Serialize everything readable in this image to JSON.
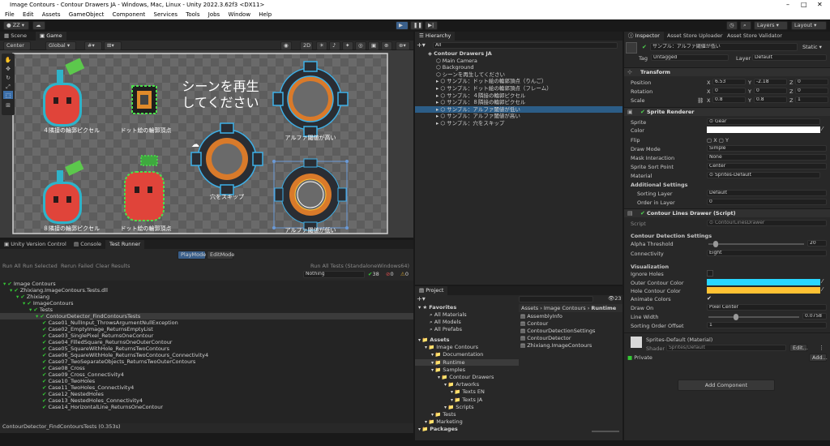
{
  "window": {
    "title": "Image Contours - Contour Drawers JA - Windows, Mac, Linux - Unity 2022.3.62f3 <DX11>"
  },
  "menu": [
    "File",
    "Edit",
    "Assets",
    "GameObject",
    "Component",
    "Services",
    "Tools",
    "Jobs",
    "Window",
    "Help"
  ],
  "toolbar": {
    "account": "ZZ",
    "layers": "Layers",
    "layout": "Layout"
  },
  "scene": {
    "tabs": [
      "Scene",
      "Game"
    ],
    "pivot": "Center",
    "space": "Global",
    "mode_2d": "2D",
    "overlay_title_line1": "シーンを再生",
    "overlay_title_line2": "してください",
    "labels": [
      "４隣接の輪郭ピクセル",
      "ドット絵の輪郭頂点",
      "アルファ閾値が高い",
      "穴をスキップ",
      "８隣接の輪郭ピクセル",
      "ドット絵の輪郭頂点",
      "アルファ閾値が低い"
    ]
  },
  "testrunner": {
    "tabs": [
      "Unity Version Control",
      "Console",
      "Test Runner"
    ],
    "modes": [
      "PlayMode",
      "EditMode"
    ],
    "actions": [
      "Run All",
      "Run Selected",
      "Rerun Failed",
      "Clear Results"
    ],
    "run_all_tests": "Run All Tests (StandaloneWindows64)",
    "filter": "Nothing",
    "counts": {
      "passed": "38",
      "failed": "0",
      "skipped": "0"
    },
    "tree": [
      {
        "label": "Image Contours",
        "indent": 0
      },
      {
        "label": "Zhixiang.ImageContours.Tests.dll",
        "indent": 1
      },
      {
        "label": "Zhixiang",
        "indent": 2
      },
      {
        "label": "ImageContours",
        "indent": 3
      },
      {
        "label": "Tests",
        "indent": 4
      },
      {
        "label": "ContourDetector_FindContoursTests",
        "indent": 5,
        "selected": true
      },
      {
        "label": "Case01_NullInput_ThrowsArgumentNullException",
        "indent": 6
      },
      {
        "label": "Case02_EmptyImage_ReturnsEmptyList",
        "indent": 6
      },
      {
        "label": "Case03_SinglePixel_ReturnsOneContour",
        "indent": 6
      },
      {
        "label": "Case04_FilledSquare_ReturnsOneOuterContour",
        "indent": 6
      },
      {
        "label": "Case05_SquareWithHole_ReturnsTwoContours",
        "indent": 6
      },
      {
        "label": "Case06_SquareWithHole_ReturnsTwoContours_Connectivity4",
        "indent": 6
      },
      {
        "label": "Case07_TwoSeparateObjects_ReturnsTwoOuterContours",
        "indent": 6
      },
      {
        "label": "Case08_Cross",
        "indent": 6
      },
      {
        "label": "Case09_Cross_Connectivity4",
        "indent": 6
      },
      {
        "label": "Case10_TwoHoles",
        "indent": 6
      },
      {
        "label": "Case11_TwoHoles_Connectivity4",
        "indent": 6
      },
      {
        "label": "Case12_NestedHoles",
        "indent": 6
      },
      {
        "label": "Case13_NestedHoles_Connectivity4",
        "indent": 6
      },
      {
        "label": "Case14_HorizontalLine_ReturnsOneContour",
        "indent": 6
      }
    ],
    "status": "ContourDetector_FindContoursTests (0.353s)"
  },
  "hierarchy": {
    "tab": "Hierarchy",
    "search": "All",
    "items": [
      {
        "label": "Contour Drawers JA",
        "indent": 0
      },
      {
        "label": "Main Camera",
        "indent": 1
      },
      {
        "label": "Background",
        "indent": 1
      },
      {
        "label": "シーンを再生してください",
        "indent": 1
      },
      {
        "label": "サンプル：ドット絵の輪郭頂点（りんご）",
        "indent": 1
      },
      {
        "label": "サンプル：ドット絵の輪郭頂点（フレーム）",
        "indent": 1
      },
      {
        "label": "サンプル：４隣接の輪郭ピクセル",
        "indent": 1
      },
      {
        "label": "サンプル：８隣接の輪郭ピクセル",
        "indent": 1
      },
      {
        "label": "サンプル：アルファ閾値が低い",
        "indent": 1,
        "selected": true
      },
      {
        "label": "サンプル：アルファ閾値が高い",
        "indent": 1
      },
      {
        "label": "サンプル：穴をスキップ",
        "indent": 1
      }
    ]
  },
  "project": {
    "tab": "Project",
    "count": "23",
    "favorites": [
      "Favorites",
      "All Materials",
      "All Models",
      "All Prefabs"
    ],
    "tree": [
      {
        "label": "Assets",
        "indent": 0
      },
      {
        "label": "Image Contours",
        "indent": 1
      },
      {
        "label": "Documentation",
        "indent": 2
      },
      {
        "label": "Runtime",
        "indent": 2,
        "selected": true
      },
      {
        "label": "Samples",
        "indent": 2
      },
      {
        "label": "Contour Drawers",
        "indent": 3
      },
      {
        "label": "Artworks",
        "indent": 4
      },
      {
        "label": "Texts EN",
        "indent": 5
      },
      {
        "label": "Texts JA",
        "indent": 5
      },
      {
        "label": "Scripts",
        "indent": 4
      },
      {
        "label": "Tests",
        "indent": 2
      },
      {
        "label": "Marketing",
        "indent": 1
      },
      {
        "label": "Packages",
        "indent": 0
      }
    ],
    "breadcrumb": [
      "Assets",
      "Image Contours",
      "Runtime"
    ],
    "files": [
      "AssemblyInfo",
      "Contour",
      "ContourDetectionSettings",
      "ContourDetector",
      "Zhixiang.ImageContours"
    ]
  },
  "inspector": {
    "tabs": [
      "Inspector",
      "Asset Store Uploader",
      "Asset Store Validator"
    ],
    "object_name": "サンプル：アルファ閾値が低い",
    "static": "Static",
    "tag_label": "Tag",
    "tag": "Untagged",
    "layer_label": "Layer",
    "layer": "Default",
    "transform": {
      "title": "Transform",
      "position": [
        "6.53",
        "-2.18",
        "0"
      ],
      "rotation": [
        "0",
        "0",
        "0"
      ],
      "scale": [
        "0.8",
        "0.8",
        "1"
      ]
    },
    "sprite_renderer": {
      "title": "Sprite Renderer",
      "sprite": "Gear",
      "color": "#ffffff",
      "flip": [
        "X",
        "Y"
      ],
      "draw_mode": "Simple",
      "mask_interaction": "None",
      "sort_point": "Center",
      "material": "Sprites-Default",
      "additional": "Additional Settings",
      "sorting_layer": "Default",
      "order_in_layer": "0"
    },
    "drawer": {
      "title": "Contour Lines Drawer (Script)",
      "script": "ContourLinesDrawer",
      "section1": "Contour Detection Settings",
      "alpha_threshold": "20",
      "alpha_fraction": 0.08,
      "connectivity": "Eight",
      "section2": "Visualization",
      "outer_color": "#29d7ff",
      "hole_color": "#ffc233",
      "draw_on": "Pixel Center",
      "line_width": "0.0758",
      "line_fraction": 0.3,
      "sorting_order_offset": "1"
    },
    "material": {
      "title": "Sprites-Default (Material)",
      "shader_label": "Shader",
      "shader": "Sprites/Default",
      "edit": "Edit...",
      "private": "Private",
      "add": "Add..."
    },
    "add_component": "Add Component"
  }
}
